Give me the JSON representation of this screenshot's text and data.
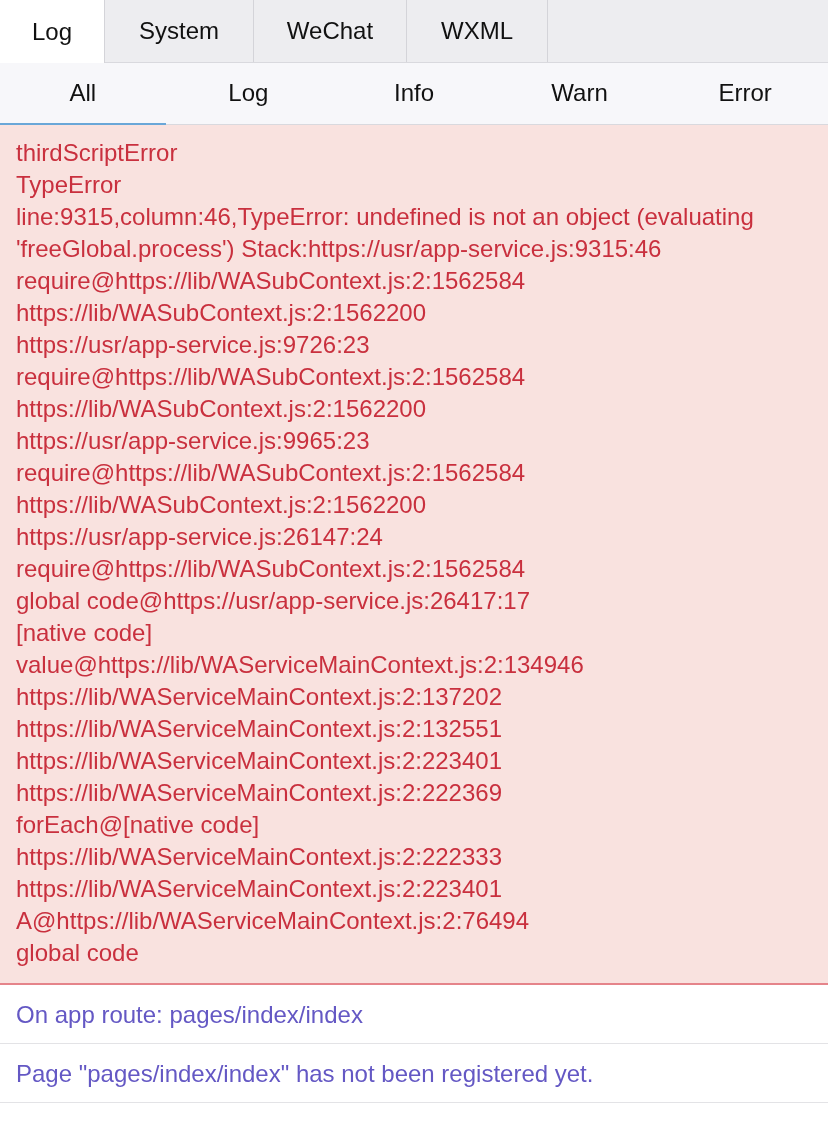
{
  "top_tabs": [
    {
      "label": "Log",
      "selected": true
    },
    {
      "label": "System",
      "selected": false
    },
    {
      "label": "WeChat",
      "selected": false
    },
    {
      "label": "WXML",
      "selected": false
    }
  ],
  "filter_tabs": [
    {
      "label": "All",
      "selected": true
    },
    {
      "label": "Log",
      "selected": false
    },
    {
      "label": "Info",
      "selected": false
    },
    {
      "label": "Warn",
      "selected": false
    },
    {
      "label": "Error",
      "selected": false
    }
  ],
  "entries": [
    {
      "kind": "error",
      "lines": [
        "thirdScriptError",
        "TypeError",
        "line:9315,column:46,TypeError: undefined is not an object (evaluating 'freeGlobal.process') Stack:https://usr/app-service.js:9315:46",
        "require@https://lib/WASubContext.js:2:1562584",
        "https://lib/WASubContext.js:2:1562200",
        "https://usr/app-service.js:9726:23",
        "require@https://lib/WASubContext.js:2:1562584",
        "https://lib/WASubContext.js:2:1562200",
        "https://usr/app-service.js:9965:23",
        "require@https://lib/WASubContext.js:2:1562584",
        "https://lib/WASubContext.js:2:1562200",
        "https://usr/app-service.js:26147:24",
        "require@https://lib/WASubContext.js:2:1562584",
        "global code@https://usr/app-service.js:26417:17",
        "[native code]",
        "value@https://lib/WAServiceMainContext.js:2:134946",
        "https://lib/WAServiceMainContext.js:2:137202",
        "https://lib/WAServiceMainContext.js:2:132551",
        "https://lib/WAServiceMainContext.js:2:223401",
        "https://lib/WAServiceMainContext.js:2:222369",
        "forEach@[native code]",
        "https://lib/WAServiceMainContext.js:2:222333",
        "https://lib/WAServiceMainContext.js:2:223401",
        "A@https://lib/WAServiceMainContext.js:2:76494",
        "global code"
      ]
    },
    {
      "kind": "info",
      "lines": [
        "On app route: pages/index/index"
      ]
    },
    {
      "kind": "info",
      "lines": [
        "Page \"pages/index/index\" has not been registered yet."
      ]
    }
  ]
}
